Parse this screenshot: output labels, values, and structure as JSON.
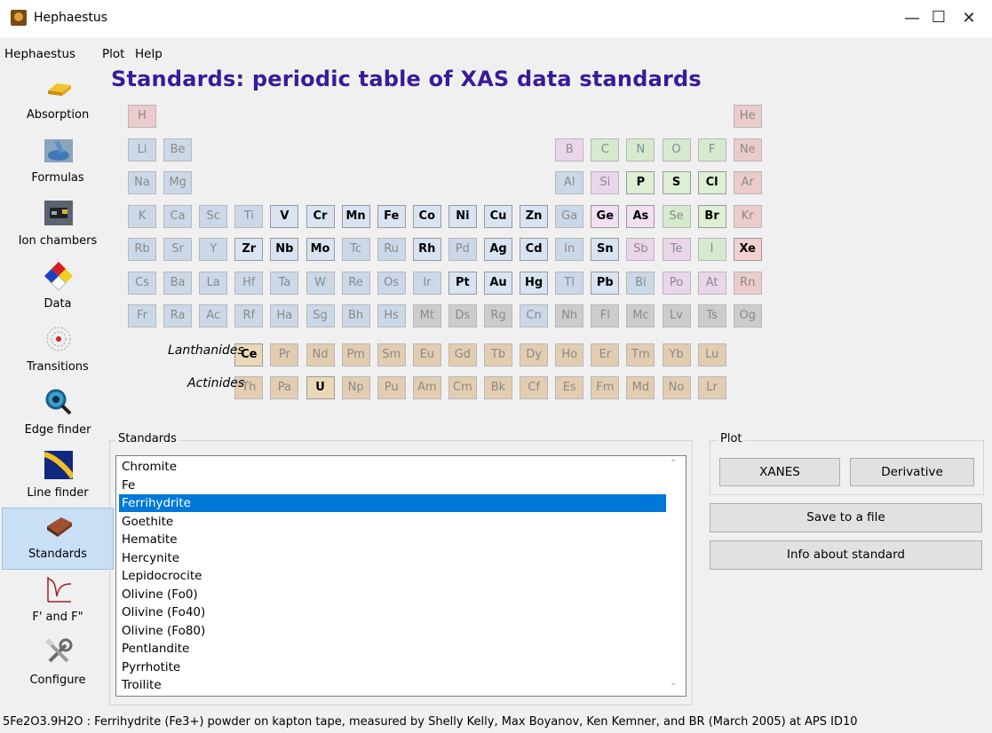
{
  "window": {
    "title": "Hephaestus",
    "controls": {
      "minimize": "—",
      "maximize": "☐",
      "close": "✕"
    }
  },
  "menu": [
    "Hephaestus",
    "Plot",
    "Help"
  ],
  "sidebar": [
    {
      "label": "Absorption",
      "icon": "gold-bar-icon"
    },
    {
      "label": "Formulas",
      "icon": "mortar-pestle-icon"
    },
    {
      "label": "Ion chambers",
      "icon": "ion-chamber-icon"
    },
    {
      "label": "Data",
      "icon": "hazard-diamond-icon"
    },
    {
      "label": "Transitions",
      "icon": "atom-icon"
    },
    {
      "label": "Edge finder",
      "icon": "magnifier-icon"
    },
    {
      "label": "Line finder",
      "icon": "spectrum-icon"
    },
    {
      "label": "Standards",
      "icon": "sample-box-icon",
      "selected": true
    },
    {
      "label": "F' and F\"",
      "icon": "anomalous-curve-icon"
    },
    {
      "label": "Configure",
      "icon": "tools-icon"
    }
  ],
  "heading": "Standards: periodic table of XAS data standards",
  "periodic_table": {
    "rows": [
      [
        {
          "s": "H",
          "c": "n"
        },
        {
          "col": 18,
          "s": "He",
          "c": "n"
        }
      ],
      [
        {
          "s": "Li",
          "c": "a"
        },
        {
          "s": "Be",
          "c": "a"
        },
        {
          "col": 13,
          "s": "B",
          "c": "m"
        },
        {
          "s": "C",
          "c": "o"
        },
        {
          "s": "N",
          "c": "o"
        },
        {
          "s": "O",
          "c": "o"
        },
        {
          "s": "F",
          "c": "h"
        },
        {
          "s": "Ne",
          "c": "n"
        }
      ],
      [
        {
          "s": "Na",
          "c": "a"
        },
        {
          "s": "Mg",
          "c": "a"
        },
        {
          "col": 13,
          "s": "Al",
          "c": "p"
        },
        {
          "s": "Si",
          "c": "m"
        },
        {
          "s": "P",
          "c": "o",
          "a": 1
        },
        {
          "s": "S",
          "c": "o",
          "a": 1
        },
        {
          "s": "Cl",
          "c": "h",
          "a": 1
        },
        {
          "s": "Ar",
          "c": "n"
        }
      ],
      [
        {
          "s": "K",
          "c": "a"
        },
        {
          "s": "Ca",
          "c": "a"
        },
        {
          "s": "Sc",
          "c": "t"
        },
        {
          "s": "Ti",
          "c": "t"
        },
        {
          "s": "V",
          "c": "t",
          "a": 1
        },
        {
          "s": "Cr",
          "c": "t",
          "a": 1
        },
        {
          "s": "Mn",
          "c": "t",
          "a": 1
        },
        {
          "s": "Fe",
          "c": "t",
          "a": 1
        },
        {
          "s": "Co",
          "c": "t",
          "a": 1
        },
        {
          "s": "Ni",
          "c": "t",
          "a": 1
        },
        {
          "s": "Cu",
          "c": "t",
          "a": 1
        },
        {
          "s": "Zn",
          "c": "t",
          "a": 1
        },
        {
          "s": "Ga",
          "c": "p"
        },
        {
          "s": "Ge",
          "c": "m",
          "a": 1
        },
        {
          "s": "As",
          "c": "m",
          "a": 1
        },
        {
          "s": "Se",
          "c": "o"
        },
        {
          "s": "Br",
          "c": "h",
          "a": 1
        },
        {
          "s": "Kr",
          "c": "n"
        }
      ],
      [
        {
          "s": "Rb",
          "c": "a"
        },
        {
          "s": "Sr",
          "c": "a"
        },
        {
          "s": "Y",
          "c": "t"
        },
        {
          "s": "Zr",
          "c": "t",
          "a": 1
        },
        {
          "s": "Nb",
          "c": "t",
          "a": 1
        },
        {
          "s": "Mo",
          "c": "t",
          "a": 1
        },
        {
          "s": "Tc",
          "c": "t"
        },
        {
          "s": "Ru",
          "c": "t"
        },
        {
          "s": "Rh",
          "c": "t",
          "a": 1
        },
        {
          "s": "Pd",
          "c": "t"
        },
        {
          "s": "Ag",
          "c": "t",
          "a": 1
        },
        {
          "s": "Cd",
          "c": "t",
          "a": 1
        },
        {
          "s": "In",
          "c": "p"
        },
        {
          "s": "Sn",
          "c": "p",
          "a": 1
        },
        {
          "s": "Sb",
          "c": "m"
        },
        {
          "s": "Te",
          "c": "m"
        },
        {
          "s": "I",
          "c": "h"
        },
        {
          "s": "Xe",
          "c": "n",
          "a": 1
        }
      ],
      [
        {
          "s": "Cs",
          "c": "a"
        },
        {
          "s": "Ba",
          "c": "a"
        },
        {
          "s": "La",
          "c": "t"
        },
        {
          "s": "Hf",
          "c": "t"
        },
        {
          "s": "Ta",
          "c": "t"
        },
        {
          "s": "W",
          "c": "t"
        },
        {
          "s": "Re",
          "c": "t"
        },
        {
          "s": "Os",
          "c": "t"
        },
        {
          "s": "Ir",
          "c": "t"
        },
        {
          "s": "Pt",
          "c": "t",
          "a": 1
        },
        {
          "s": "Au",
          "c": "t",
          "a": 1
        },
        {
          "s": "Hg",
          "c": "t",
          "a": 1
        },
        {
          "s": "Tl",
          "c": "p"
        },
        {
          "s": "Pb",
          "c": "p",
          "a": 1
        },
        {
          "s": "Bi",
          "c": "p"
        },
        {
          "s": "Po",
          "c": "m"
        },
        {
          "s": "At",
          "c": "m"
        },
        {
          "s": "Rn",
          "c": "n"
        }
      ],
      [
        {
          "s": "Fr",
          "c": "a"
        },
        {
          "s": "Ra",
          "c": "a"
        },
        {
          "s": "Ac",
          "c": "t"
        },
        {
          "s": "Rf",
          "c": "t"
        },
        {
          "s": "Ha",
          "c": "t"
        },
        {
          "s": "Sg",
          "c": "t"
        },
        {
          "s": "Bh",
          "c": "t"
        },
        {
          "s": "Hs",
          "c": "t"
        },
        {
          "s": "Mt",
          "c": "u"
        },
        {
          "s": "Ds",
          "c": "u"
        },
        {
          "s": "Rg",
          "c": "u"
        },
        {
          "s": "Cn",
          "c": "t"
        },
        {
          "s": "Nh",
          "c": "u"
        },
        {
          "s": "Fl",
          "c": "u"
        },
        {
          "s": "Mc",
          "c": "u"
        },
        {
          "s": "Lv",
          "c": "u"
        },
        {
          "s": "Ts",
          "c": "u"
        },
        {
          "s": "Og",
          "c": "u"
        }
      ],
      [
        {
          "col": 4,
          "s": "Ce",
          "c": "l",
          "a": 1
        },
        {
          "s": "Pr",
          "c": "l"
        },
        {
          "s": "Nd",
          "c": "l"
        },
        {
          "s": "Pm",
          "c": "l"
        },
        {
          "s": "Sm",
          "c": "l"
        },
        {
          "s": "Eu",
          "c": "l"
        },
        {
          "s": "Gd",
          "c": "l"
        },
        {
          "s": "Tb",
          "c": "l"
        },
        {
          "s": "Dy",
          "c": "l"
        },
        {
          "s": "Ho",
          "c": "l"
        },
        {
          "s": "Er",
          "c": "l"
        },
        {
          "s": "Tm",
          "c": "l"
        },
        {
          "s": "Yb",
          "c": "l"
        },
        {
          "s": "Lu",
          "c": "l"
        }
      ],
      [
        {
          "col": 4,
          "s": "Th",
          "c": "l"
        },
        {
          "s": "Pa",
          "c": "l"
        },
        {
          "s": "U",
          "c": "l",
          "a": 1
        },
        {
          "s": "Np",
          "c": "l"
        },
        {
          "s": "Pu",
          "c": "l"
        },
        {
          "s": "Am",
          "c": "l"
        },
        {
          "s": "Cm",
          "c": "l"
        },
        {
          "s": "Bk",
          "c": "l"
        },
        {
          "s": "Cf",
          "c": "l"
        },
        {
          "s": "Es",
          "c": "l"
        },
        {
          "s": "Fm",
          "c": "l"
        },
        {
          "s": "Md",
          "c": "l"
        },
        {
          "s": "No",
          "c": "l"
        },
        {
          "s": "Lr",
          "c": "l"
        }
      ]
    ],
    "series_labels": {
      "lanthanides": "Lanthanides",
      "actinides": "Actinides"
    },
    "colors": {
      "a": "#cbd8e8",
      "t": "#cbd8e8",
      "p": "#cbd8e8",
      "m": "#ead6ea",
      "o": "#d6ead0",
      "h": "#d6ead0",
      "n": "#ebcbcb",
      "l": "#e3cdb0",
      "u": "#cccccc"
    },
    "available_bg": {
      "a": "#d8e4f2",
      "t": "#d8e4f2",
      "p": "#d8e4f2",
      "m": "#f2dff2",
      "o": "#ddf0d6",
      "h": "#ddf0d6",
      "n": "#f2d0d0",
      "l": "#ead8b8",
      "u": "#d4d4d4"
    },
    "text_available": "#000000",
    "text_unavailable": "#8a8a8a"
  },
  "standards": {
    "title": "Standards",
    "items": [
      "Chromite",
      "Fe",
      "Ferrihydrite",
      "Goethite",
      "Hematite",
      "Hercynite",
      "Lepidocrocite",
      "Olivine (Fo0)",
      "Olivine (Fo40)",
      "Olivine (Fo80)",
      "Pentlandite",
      "Pyrrhotite",
      "Troilite"
    ],
    "selected_index": 2,
    "scroll_up": "⌃",
    "scroll_down": "⌄"
  },
  "plot": {
    "title": "Plot",
    "xanes": "XANES",
    "derivative": "Derivative"
  },
  "actions": {
    "save": "Save to a file",
    "info": "Info about standard"
  },
  "status": "5Fe2O3.9H2O : Ferrihydrite (Fe3+) powder on kapton tape, measured by Shelly Kelly, Max Boyanov, Ken Kemner, and BR (March 2005) at APS ID10"
}
